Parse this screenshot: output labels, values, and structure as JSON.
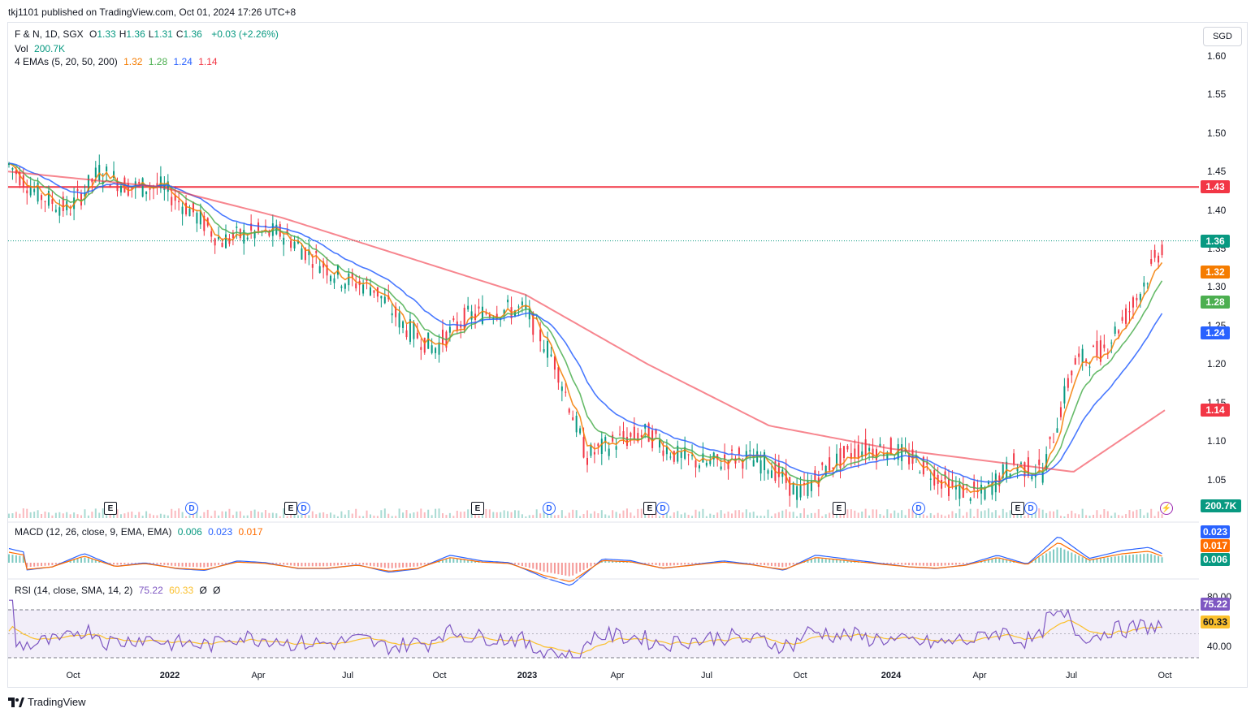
{
  "header": {
    "publisher": "tkj1101 published on TradingView.com, Oct 01, 2024 17:26 UTC+8",
    "symbol": "F & N, 1D, SGX",
    "ohlc": [
      {
        "k": "O",
        "v": "1.33"
      },
      {
        "k": "H",
        "v": "1.36"
      },
      {
        "k": "L",
        "v": "1.31"
      },
      {
        "k": "C",
        "v": "1.36"
      }
    ],
    "change": "+0.03 (+2.26%)",
    "vol_label": "Vol",
    "vol_value": "200.7K",
    "ema_label": "4 EMAs (5, 20, 50, 200)",
    "ema_values": [
      "1.32",
      "1.28",
      "1.24",
      "1.14"
    ],
    "currency": "SGD"
  },
  "macd": {
    "label": "MACD (12, 26, close, 9, EMA, EMA)",
    "values": [
      "0.006",
      "0.023",
      "0.017"
    ],
    "badges": [
      "0.023",
      "0.017",
      "0.006"
    ]
  },
  "rsi": {
    "label": "RSI (14, close, SMA, 14, 2)",
    "values": [
      "75.22",
      "60.33",
      "Ø",
      "Ø"
    ],
    "badges": [
      "75.22",
      "60.33"
    ],
    "axis": [
      "80.00",
      "40.00"
    ]
  },
  "colors": {
    "up": "#089981",
    "down": "#f23645",
    "ema5": "#f57c00",
    "ema20": "#4caf50",
    "ema50": "#2962ff",
    "ema200": "#f23645",
    "hline": "#f23645",
    "last": "#089981",
    "macd": "#2962ff",
    "signal": "#ff6d00",
    "rsi": "#7e57c2",
    "rsima": "#fbc02d",
    "rsiband": "#ede7f6"
  },
  "chart_data": {
    "type": "candlestick",
    "ylim": [
      1.0,
      1.62
    ],
    "y_ticks": [
      "1.60",
      "1.55",
      "1.50",
      "1.45",
      "1.40",
      "1.35",
      "1.30",
      "1.25",
      "1.20",
      "1.15",
      "1.10",
      "1.05"
    ],
    "x_ticks": [
      {
        "label": "Oct",
        "bold": false
      },
      {
        "label": "2022",
        "bold": true
      },
      {
        "label": "Apr",
        "bold": false
      },
      {
        "label": "Jul",
        "bold": false
      },
      {
        "label": "Oct",
        "bold": false
      },
      {
        "label": "2023",
        "bold": true
      },
      {
        "label": "Apr",
        "bold": false
      },
      {
        "label": "Jul",
        "bold": false
      },
      {
        "label": "Oct",
        "bold": false
      },
      {
        "label": "2024",
        "bold": true
      },
      {
        "label": "Apr",
        "bold": false
      },
      {
        "label": "Jul",
        "bold": false
      },
      {
        "label": "Oct",
        "bold": false
      }
    ],
    "events": [
      {
        "type": "E",
        "text": "E"
      },
      {
        "type": "D",
        "text": "D"
      },
      {
        "type": "E",
        "text": "E"
      },
      {
        "type": "D",
        "text": "D"
      },
      {
        "type": "E",
        "text": "E"
      },
      {
        "type": "D",
        "text": "D"
      },
      {
        "type": "E",
        "text": "E"
      },
      {
        "type": "D",
        "text": "D"
      },
      {
        "type": "E",
        "text": "E"
      },
      {
        "type": "D",
        "text": "D"
      },
      {
        "type": "E",
        "text": "E"
      },
      {
        "type": "D",
        "text": "D"
      }
    ],
    "horizontal_line": 1.43,
    "last_price": 1.36,
    "price_badges": [
      {
        "label": "1.43",
        "value": 1.43,
        "color": "#f23645"
      },
      {
        "label": "1.36",
        "value": 1.36,
        "color": "#089981"
      },
      {
        "label": "1.32",
        "value": 1.32,
        "color": "#f57c00"
      },
      {
        "label": "1.28",
        "value": 1.28,
        "color": "#4caf50"
      },
      {
        "label": "1.24",
        "value": 1.24,
        "color": "#2962ff"
      },
      {
        "label": "1.14",
        "value": 1.14,
        "color": "#f23645"
      }
    ],
    "volume_badge": "200.7K",
    "close_path": [
      [
        "2021-08",
        1.46
      ],
      [
        "2021-09",
        1.42
      ],
      [
        "2021-10",
        1.4
      ],
      [
        "2021-11",
        1.45
      ],
      [
        "2021-12",
        1.43
      ],
      [
        "2022-01",
        1.43
      ],
      [
        "2022-02",
        1.4
      ],
      [
        "2022-03",
        1.36
      ],
      [
        "2022-04",
        1.37
      ],
      [
        "2022-05",
        1.37
      ],
      [
        "2022-06",
        1.34
      ],
      [
        "2022-07",
        1.31
      ],
      [
        "2022-08",
        1.3
      ],
      [
        "2022-09",
        1.25
      ],
      [
        "2022-10",
        1.22
      ],
      [
        "2022-11",
        1.26
      ],
      [
        "2022-12",
        1.27
      ],
      [
        "2023-01",
        1.27
      ],
      [
        "2023-02",
        1.2
      ],
      [
        "2023-03",
        1.08
      ],
      [
        "2023-04",
        1.1
      ],
      [
        "2023-05",
        1.11
      ],
      [
        "2023-06",
        1.08
      ],
      [
        "2023-07",
        1.07
      ],
      [
        "2023-08",
        1.08
      ],
      [
        "2023-09",
        1.07
      ],
      [
        "2023-10",
        1.03
      ],
      [
        "2023-11",
        1.07
      ],
      [
        "2023-12",
        1.09
      ],
      [
        "2024-01",
        1.09
      ],
      [
        "2024-02",
        1.07
      ],
      [
        "2024-03",
        1.04
      ],
      [
        "2024-04",
        1.03
      ],
      [
        "2024-05",
        1.07
      ],
      [
        "2024-06",
        1.06
      ],
      [
        "2024-07",
        1.2
      ],
      [
        "2024-08",
        1.22
      ],
      [
        "2024-09",
        1.28
      ],
      [
        "2024-10",
        1.36
      ]
    ],
    "ema200_path": [
      [
        "2021-08",
        1.45
      ],
      [
        "2022-01",
        1.43
      ],
      [
        "2022-05",
        1.39
      ],
      [
        "2022-09",
        1.34
      ],
      [
        "2023-01",
        1.29
      ],
      [
        "2023-05",
        1.2
      ],
      [
        "2023-09",
        1.12
      ],
      [
        "2024-01",
        1.09
      ],
      [
        "2024-05",
        1.07
      ],
      [
        "2024-07",
        1.06
      ],
      [
        "2024-10",
        1.14
      ]
    ]
  }
}
